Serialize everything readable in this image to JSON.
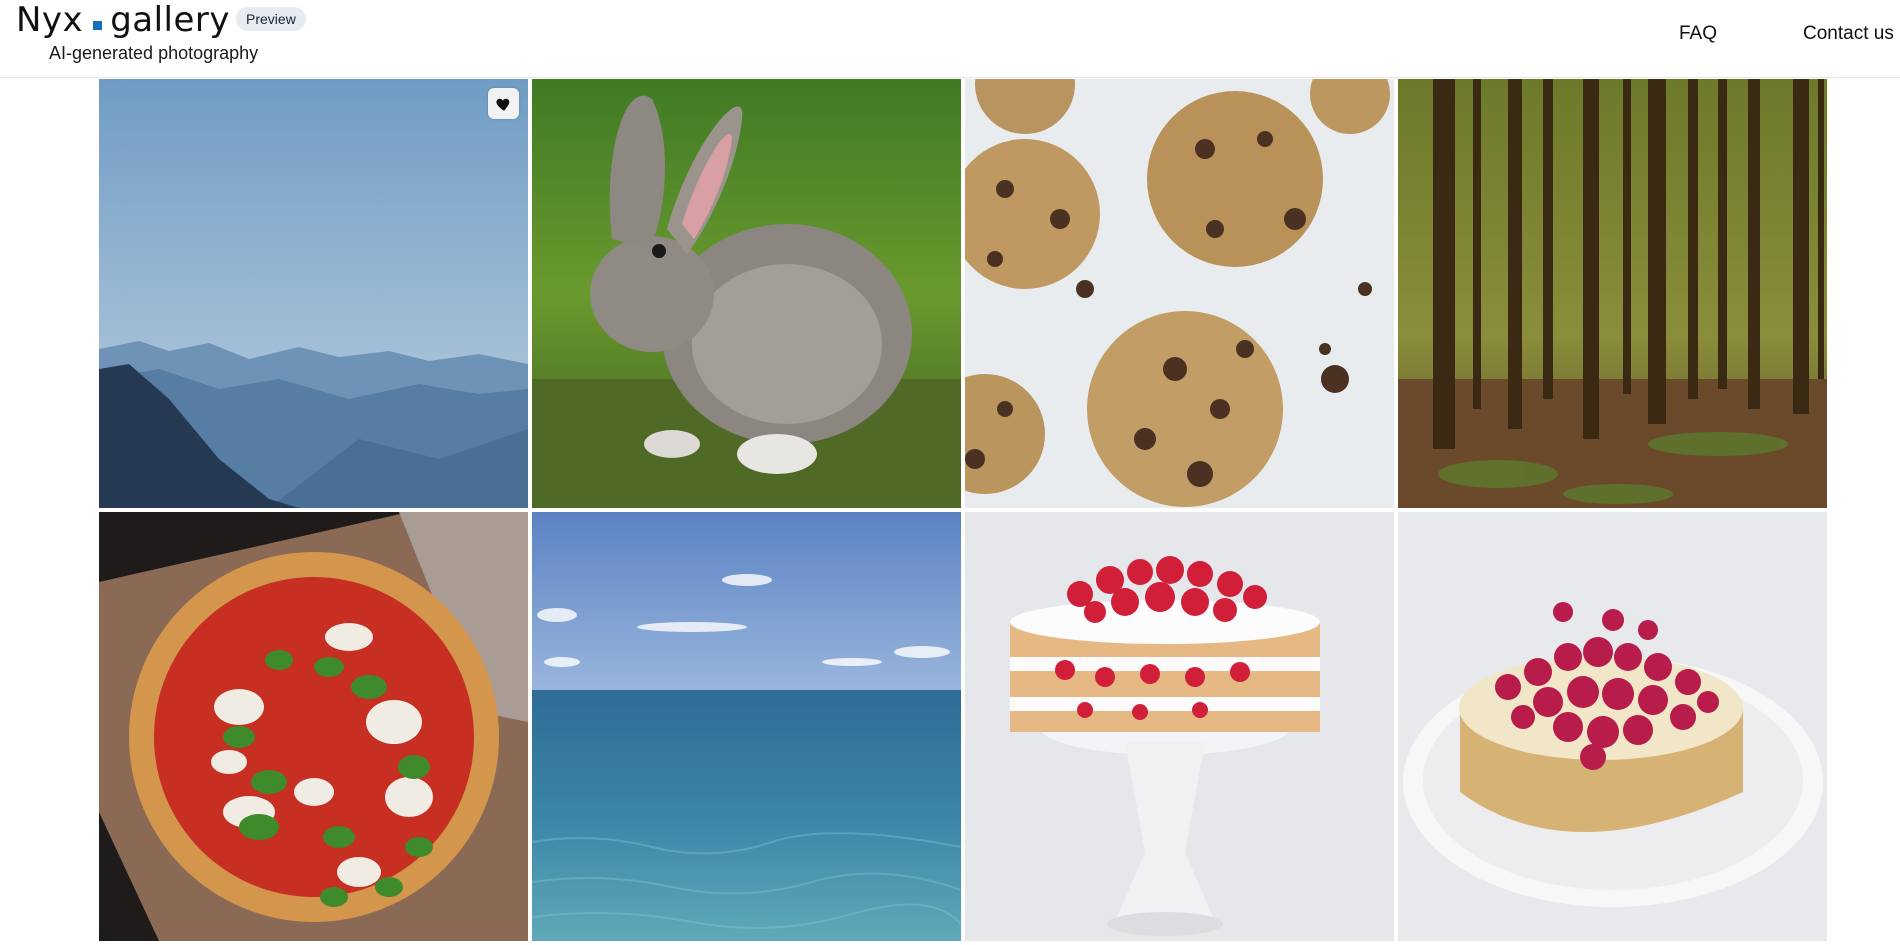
{
  "header": {
    "logo_left": "Nyx",
    "logo_right": "gallery",
    "badge": "Preview",
    "tagline": "AI-generated photography"
  },
  "nav": {
    "faq": "FAQ",
    "contact": "Contact us"
  },
  "colors": {
    "accent": "#1670b8",
    "badge_bg": "#e6ebf1"
  },
  "gallery": [
    {
      "subject": "misty blue mountains",
      "favorite_icon": "heart-icon"
    },
    {
      "subject": "grey rabbit on grass"
    },
    {
      "subject": "chocolate chip cookies"
    },
    {
      "subject": "pine forest"
    },
    {
      "subject": "margherita pizza in box"
    },
    {
      "subject": "ocean and blue sky"
    },
    {
      "subject": "layered strawberry cake on stand"
    },
    {
      "subject": "raspberry cheesecake on plate"
    }
  ]
}
